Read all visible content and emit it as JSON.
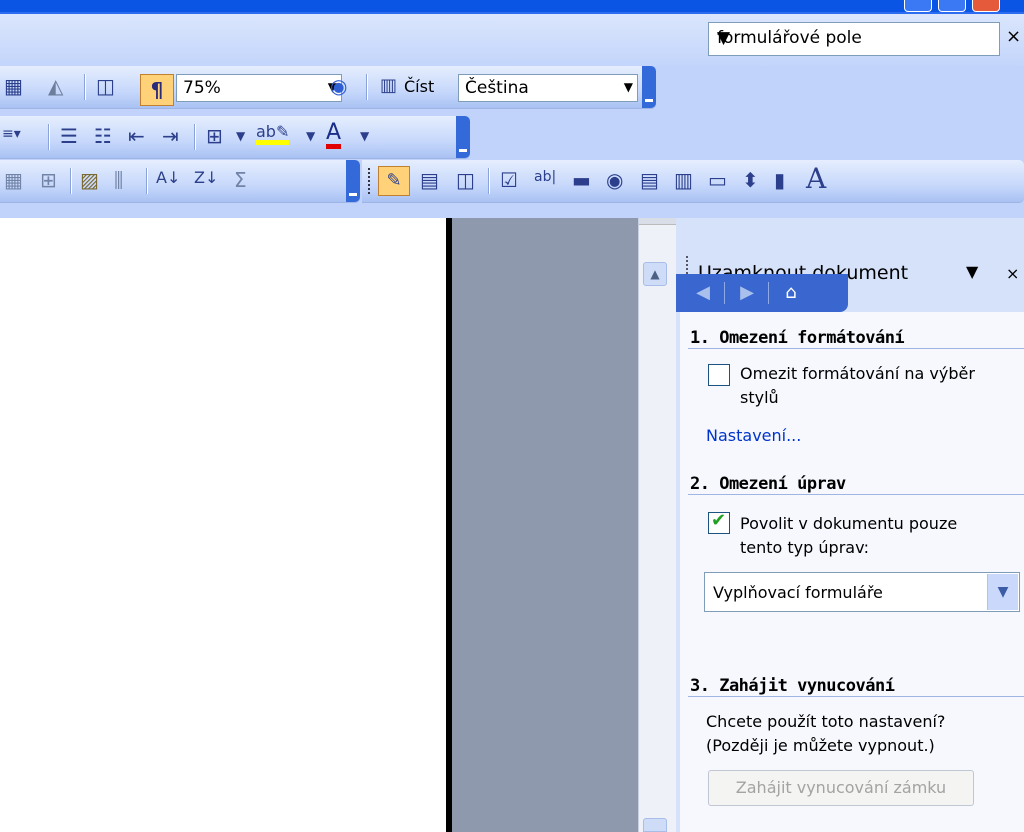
{
  "help": {
    "query": "formulářové pole"
  },
  "toolbar1": {
    "zoom": "75%",
    "read_label": "Číst",
    "language": "Čeština"
  },
  "pane": {
    "title": "Uzamknout dokument",
    "section1": {
      "heading": "1. Omezení formátování",
      "checkbox_label_line1": "Omezit formátování na výběr",
      "checkbox_label_line2": "stylů",
      "checked": false,
      "link": "Nastavení..."
    },
    "section2": {
      "heading": "2. Omezení úprav",
      "checkbox_label_line1": "Povolit v dokumentu pouze",
      "checkbox_label_line2": "tento typ úprav:",
      "checked": true,
      "edit_type": "Vyplňovací formuláře"
    },
    "section3": {
      "heading": "3. Zahájit vynucování",
      "question_line1": "Chcete použít toto nastavení?",
      "question_line2": "(Později je můžete vypnout.)",
      "button": "Zahájit vynucování zámku"
    }
  },
  "icons": {
    "toolbar1": [
      "columns-icon",
      "drawing-icon",
      "document-map-icon",
      "show-hide-marks-icon",
      "help-icon",
      "read-mode-icon"
    ],
    "toolbar2": [
      "numbering-icon",
      "bullets-icon",
      "decrease-indent-icon",
      "increase-indent-icon",
      "border-icon",
      "highlight-icon",
      "font-color-icon"
    ],
    "toolbar3": [
      "table-icon",
      "insert-table-icon",
      "autoformat-icon",
      "distribute-columns-icon",
      "sort-ascending-icon",
      "sort-descending-icon",
      "autosum-icon",
      "design-mode-icon",
      "properties-icon",
      "form-icon",
      "checkbox-control-icon",
      "textbox-control-icon",
      "button-control-icon",
      "option-button-icon",
      "listbox-icon",
      "combo-icon",
      "toggle-icon",
      "spin-icon",
      "scrollbar-icon",
      "label-icon"
    ]
  },
  "colors": {
    "accent": "#3a66d0",
    "link": "#0033cc",
    "check": "#21a121"
  }
}
